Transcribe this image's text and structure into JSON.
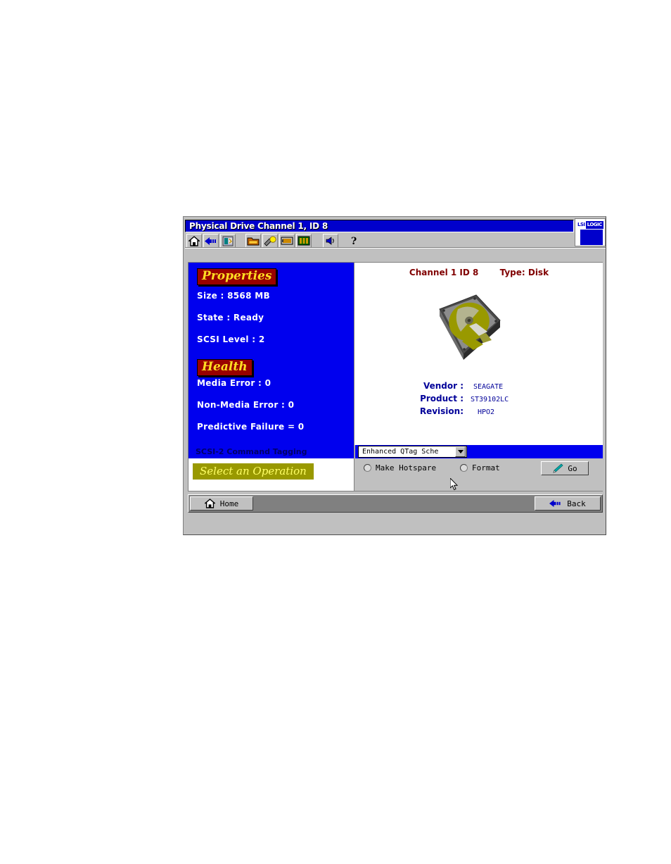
{
  "window": {
    "title": "Physical Drive Channel 1, ID 8",
    "logo": {
      "lsi": "LSI",
      "logic": "LOGIC"
    }
  },
  "toolbar": {
    "buttons": [
      {
        "name": "home-icon",
        "tip": "Home"
      },
      {
        "name": "back-arrow-icon",
        "tip": "Back"
      },
      {
        "name": "configure-icon",
        "tip": "Configure"
      },
      {
        "name": "folder-icon",
        "tip": "Open"
      },
      {
        "name": "flashlight-icon",
        "tip": "Scan"
      },
      {
        "name": "card-icon",
        "tip": "Controller"
      },
      {
        "name": "enclosure-icon",
        "tip": "Enclosure"
      },
      {
        "name": "speaker-icon",
        "tip": "Alarm"
      },
      {
        "name": "help-icon",
        "tip": "Help"
      }
    ]
  },
  "properties": {
    "heading": "Properties",
    "size": "Size  :  8568 MB",
    "state": "State  :  Ready",
    "scsi_level": "SCSI Level  :  2"
  },
  "health": {
    "heading": "Health",
    "media_error": "Media Error  :  0",
    "non_media_error": "Non-Media Error  :  0",
    "predictive_failure": "Predictive Failure = 0"
  },
  "drive": {
    "channel": "Channel 1 ID 8",
    "type": "Type: Disk",
    "vendor_label": "Vendor :",
    "vendor_value": "SEAGATE",
    "product_label": "Product :",
    "product_value": "ST39102LC",
    "revision_label": "Revision:",
    "revision_value": "HPO2"
  },
  "operations": {
    "tagging_label": "SCSI-2 Command Tagging",
    "tagging_value": "Enhanced QTag Sche",
    "select_operation": "Select an Operation",
    "radio_hotspare": "Make Hotspare",
    "radio_format": "Format",
    "go_label": "Go"
  },
  "navigation": {
    "home": "Home",
    "back": "Back"
  },
  "colors": {
    "title_blue": "#0000cc",
    "panel_blue": "#0000ee",
    "badge_red": "#990000",
    "badge_yellow": "#ffdd22",
    "olive": "#999900",
    "maroon_text": "#800000",
    "chrome_gray": "#c0c0c0"
  }
}
